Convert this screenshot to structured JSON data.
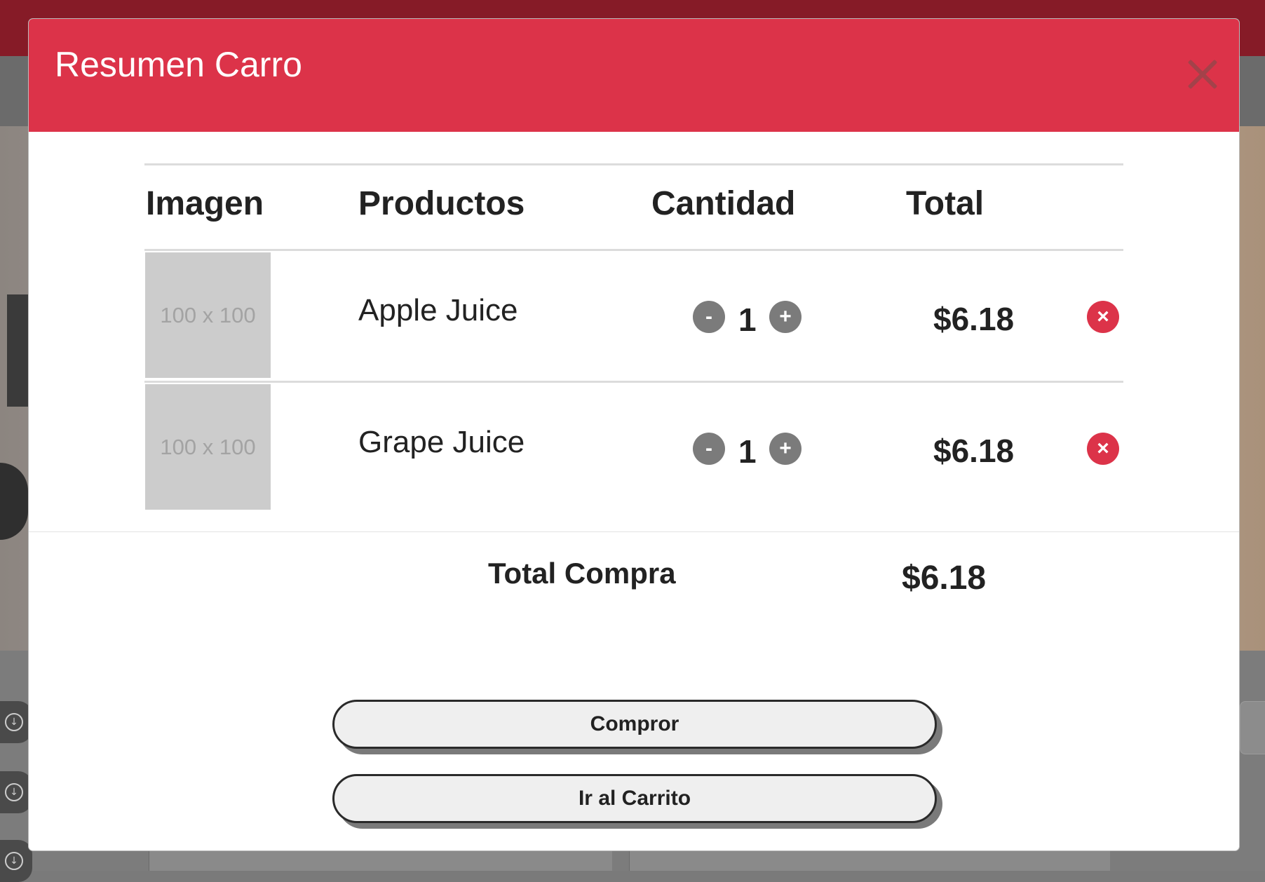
{
  "modal": {
    "title": "Resumen Carro",
    "close_icon": "close-icon"
  },
  "table": {
    "headers": [
      "Imagen",
      "Productos",
      "Cantidad",
      "Total"
    ],
    "rows": [
      {
        "image_placeholder": "100 x 100",
        "product": "Apple Juice",
        "quantity": "1",
        "total": "$6.18",
        "decrement": "-",
        "increment": "+",
        "remove": "×"
      },
      {
        "image_placeholder": "100 x 100",
        "product": "Grape Juice",
        "quantity": "1",
        "total": "$6.18",
        "decrement": "-",
        "increment": "+",
        "remove": "×"
      }
    ]
  },
  "summary": {
    "label": "Total Compra",
    "value": "$6.18"
  },
  "buttons": {
    "buy": "Compror",
    "go_to_cart": "Ir al Carrito"
  },
  "colors": {
    "header": "#dc3349",
    "remove": "#dc3349",
    "quantity_buttons": "#7b7b7b"
  }
}
